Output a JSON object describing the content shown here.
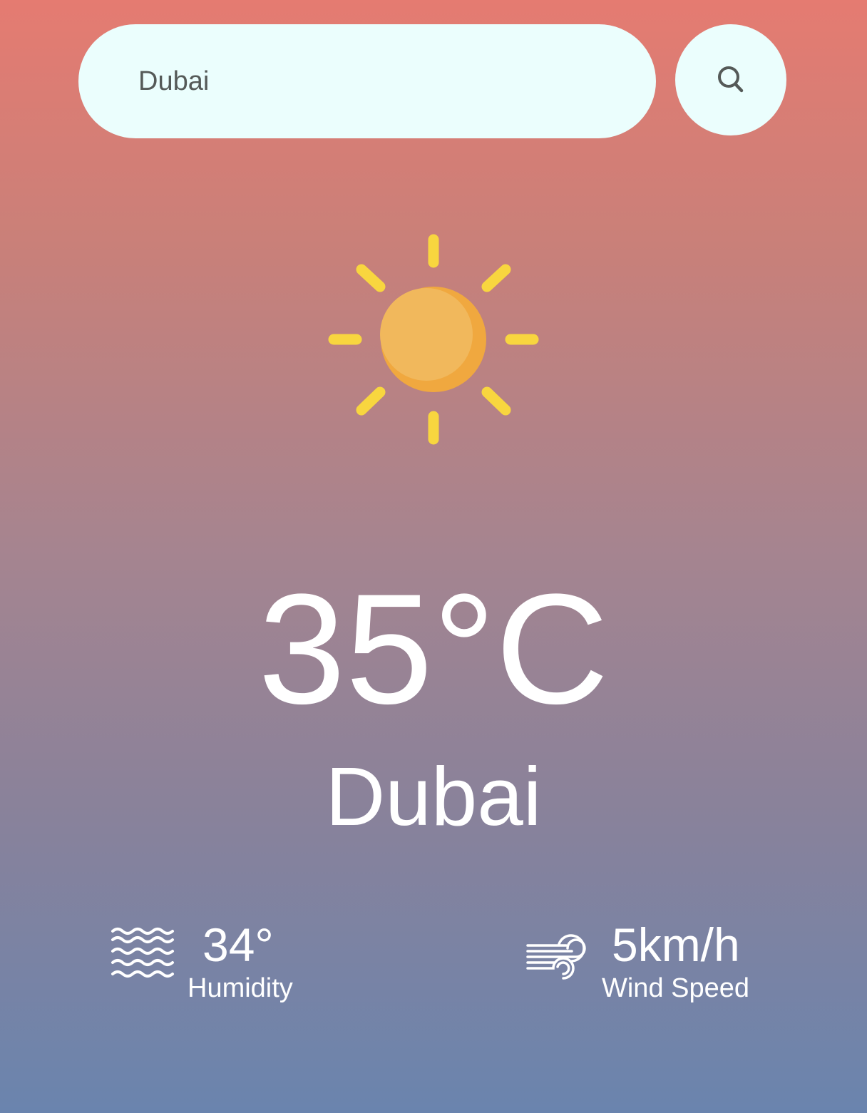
{
  "search": {
    "value": "Dubai",
    "placeholder": ""
  },
  "icons": {
    "search": "search-icon",
    "weather": "sun-icon",
    "humidity": "humidity-waves-icon",
    "wind": "wind-icon"
  },
  "weather": {
    "temperature": "35°C",
    "city": "Dubai"
  },
  "stats": {
    "humidity_value": "34°",
    "humidity_label": "Humidity",
    "wind_value": "5km/h",
    "wind_label": "Wind Speed"
  },
  "colors": {
    "gradient_top": "#e57b71",
    "gradient_bottom": "#6a84ae",
    "search_background": "#ebfefd",
    "sun_ray": "#f8d63f",
    "sun_body": "#f1b85c",
    "sun_shade": "#f0a83f",
    "text": "#ffffff"
  }
}
